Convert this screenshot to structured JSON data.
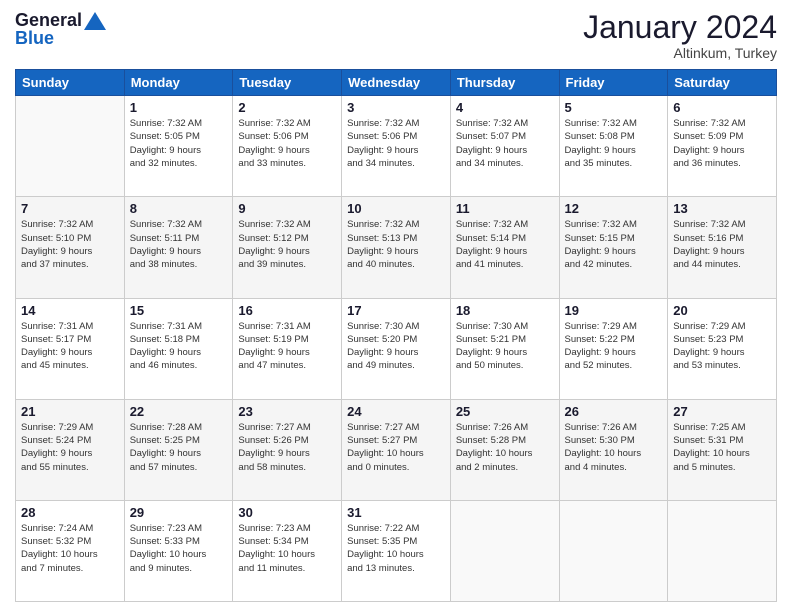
{
  "header": {
    "logo_line1": "General",
    "logo_line2": "Blue",
    "month_title": "January 2024",
    "subtitle": "Altinkum, Turkey"
  },
  "days_of_week": [
    "Sunday",
    "Monday",
    "Tuesday",
    "Wednesday",
    "Thursday",
    "Friday",
    "Saturday"
  ],
  "weeks": [
    [
      {
        "day": "",
        "info": ""
      },
      {
        "day": "1",
        "info": "Sunrise: 7:32 AM\nSunset: 5:05 PM\nDaylight: 9 hours\nand 32 minutes."
      },
      {
        "day": "2",
        "info": "Sunrise: 7:32 AM\nSunset: 5:06 PM\nDaylight: 9 hours\nand 33 minutes."
      },
      {
        "day": "3",
        "info": "Sunrise: 7:32 AM\nSunset: 5:06 PM\nDaylight: 9 hours\nand 34 minutes."
      },
      {
        "day": "4",
        "info": "Sunrise: 7:32 AM\nSunset: 5:07 PM\nDaylight: 9 hours\nand 34 minutes."
      },
      {
        "day": "5",
        "info": "Sunrise: 7:32 AM\nSunset: 5:08 PM\nDaylight: 9 hours\nand 35 minutes."
      },
      {
        "day": "6",
        "info": "Sunrise: 7:32 AM\nSunset: 5:09 PM\nDaylight: 9 hours\nand 36 minutes."
      }
    ],
    [
      {
        "day": "7",
        "info": "Sunrise: 7:32 AM\nSunset: 5:10 PM\nDaylight: 9 hours\nand 37 minutes."
      },
      {
        "day": "8",
        "info": "Sunrise: 7:32 AM\nSunset: 5:11 PM\nDaylight: 9 hours\nand 38 minutes."
      },
      {
        "day": "9",
        "info": "Sunrise: 7:32 AM\nSunset: 5:12 PM\nDaylight: 9 hours\nand 39 minutes."
      },
      {
        "day": "10",
        "info": "Sunrise: 7:32 AM\nSunset: 5:13 PM\nDaylight: 9 hours\nand 40 minutes."
      },
      {
        "day": "11",
        "info": "Sunrise: 7:32 AM\nSunset: 5:14 PM\nDaylight: 9 hours\nand 41 minutes."
      },
      {
        "day": "12",
        "info": "Sunrise: 7:32 AM\nSunset: 5:15 PM\nDaylight: 9 hours\nand 42 minutes."
      },
      {
        "day": "13",
        "info": "Sunrise: 7:32 AM\nSunset: 5:16 PM\nDaylight: 9 hours\nand 44 minutes."
      }
    ],
    [
      {
        "day": "14",
        "info": "Sunrise: 7:31 AM\nSunset: 5:17 PM\nDaylight: 9 hours\nand 45 minutes."
      },
      {
        "day": "15",
        "info": "Sunrise: 7:31 AM\nSunset: 5:18 PM\nDaylight: 9 hours\nand 46 minutes."
      },
      {
        "day": "16",
        "info": "Sunrise: 7:31 AM\nSunset: 5:19 PM\nDaylight: 9 hours\nand 47 minutes."
      },
      {
        "day": "17",
        "info": "Sunrise: 7:30 AM\nSunset: 5:20 PM\nDaylight: 9 hours\nand 49 minutes."
      },
      {
        "day": "18",
        "info": "Sunrise: 7:30 AM\nSunset: 5:21 PM\nDaylight: 9 hours\nand 50 minutes."
      },
      {
        "day": "19",
        "info": "Sunrise: 7:29 AM\nSunset: 5:22 PM\nDaylight: 9 hours\nand 52 minutes."
      },
      {
        "day": "20",
        "info": "Sunrise: 7:29 AM\nSunset: 5:23 PM\nDaylight: 9 hours\nand 53 minutes."
      }
    ],
    [
      {
        "day": "21",
        "info": "Sunrise: 7:29 AM\nSunset: 5:24 PM\nDaylight: 9 hours\nand 55 minutes."
      },
      {
        "day": "22",
        "info": "Sunrise: 7:28 AM\nSunset: 5:25 PM\nDaylight: 9 hours\nand 57 minutes."
      },
      {
        "day": "23",
        "info": "Sunrise: 7:27 AM\nSunset: 5:26 PM\nDaylight: 9 hours\nand 58 minutes."
      },
      {
        "day": "24",
        "info": "Sunrise: 7:27 AM\nSunset: 5:27 PM\nDaylight: 10 hours\nand 0 minutes."
      },
      {
        "day": "25",
        "info": "Sunrise: 7:26 AM\nSunset: 5:28 PM\nDaylight: 10 hours\nand 2 minutes."
      },
      {
        "day": "26",
        "info": "Sunrise: 7:26 AM\nSunset: 5:30 PM\nDaylight: 10 hours\nand 4 minutes."
      },
      {
        "day": "27",
        "info": "Sunrise: 7:25 AM\nSunset: 5:31 PM\nDaylight: 10 hours\nand 5 minutes."
      }
    ],
    [
      {
        "day": "28",
        "info": "Sunrise: 7:24 AM\nSunset: 5:32 PM\nDaylight: 10 hours\nand 7 minutes."
      },
      {
        "day": "29",
        "info": "Sunrise: 7:23 AM\nSunset: 5:33 PM\nDaylight: 10 hours\nand 9 minutes."
      },
      {
        "day": "30",
        "info": "Sunrise: 7:23 AM\nSunset: 5:34 PM\nDaylight: 10 hours\nand 11 minutes."
      },
      {
        "day": "31",
        "info": "Sunrise: 7:22 AM\nSunset: 5:35 PM\nDaylight: 10 hours\nand 13 minutes."
      },
      {
        "day": "",
        "info": ""
      },
      {
        "day": "",
        "info": ""
      },
      {
        "day": "",
        "info": ""
      }
    ]
  ]
}
